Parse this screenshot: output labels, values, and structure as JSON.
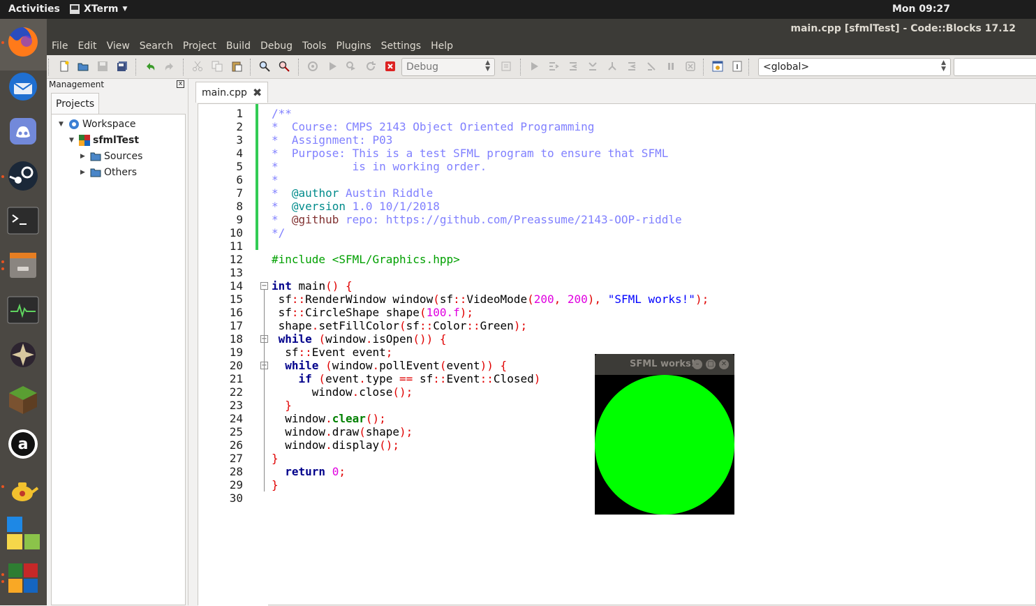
{
  "topbar": {
    "activities": "Activities",
    "app": "XTerm",
    "clock": "Mon 09:27"
  },
  "window": {
    "title": "main.cpp [sfmlTest] - Code::Blocks 17.12"
  },
  "menu": [
    "File",
    "Edit",
    "View",
    "Search",
    "Project",
    "Build",
    "Debug",
    "Tools",
    "Plugins",
    "Settings",
    "Help"
  ],
  "toolbar": {
    "build_target": "Debug",
    "scope": "<global>"
  },
  "management": {
    "header": "Management",
    "close": "x",
    "tab": "Projects",
    "tree": {
      "workspace": "Workspace",
      "project": "sfmlTest",
      "sources": "Sources",
      "others": "Others"
    }
  },
  "editor": {
    "tab": "main.cpp",
    "tab_close": "✖",
    "line_numbers": [
      "1",
      "2",
      "3",
      "4",
      "5",
      "6",
      "7",
      "8",
      "9",
      "10",
      "11",
      "12",
      "13",
      "14",
      "15",
      "16",
      "17",
      "18",
      "19",
      "20",
      "21",
      "22",
      "23",
      "24",
      "25",
      "26",
      "27",
      "28",
      "29",
      "30"
    ],
    "lines": {
      "l1": "/**",
      "l2": "*  Course: CMPS 2143 Object Oriented Programming",
      "l3": "*  Assignment: P03",
      "l4": "*  Purpose: This is a test SFML program to ensure that SFML",
      "l5": "*           is in working order.",
      "l6": "*",
      "l7_a": "*  ",
      "l7_b": "@author",
      "l7_c": " Austin Riddle",
      "l8_a": "*  ",
      "l8_b": "@version",
      "l8_c": " 1.0 10/1/2018",
      "l9_a": "*  ",
      "l9_b": "@github",
      "l9_c": " repo: https://github.com/Preassume/2143-OOP-riddle",
      "l10": "*/",
      "l12": "#include <SFML/Graphics.hpp>",
      "l14_kw": "int",
      "l14_a": " main",
      "l14_b": "()",
      "l14_c": " ",
      "l14_d": "{",
      "l15_a": " sf",
      "l15_b": "::",
      "l15_c": "RenderWindow window",
      "l15_d": "(",
      "l15_e": "sf",
      "l15_f": "::",
      "l15_g": "VideoMode",
      "l15_h": "(",
      "l15_i": "200",
      "l15_j": ", ",
      "l15_k": "200",
      "l15_l": "), ",
      "l15_m": "\"SFML works!\"",
      "l15_n": ");",
      "l16_a": " sf",
      "l16_b": "::",
      "l16_c": "CircleShape shape",
      "l16_d": "(",
      "l16_e": "100.f",
      "l16_f": ");",
      "l17_a": " shape",
      "l17_b": ".",
      "l17_c": "setFillColor",
      "l17_d": "(",
      "l17_e": "sf",
      "l17_f": "::",
      "l17_g": "Color",
      "l17_h": "::",
      "l17_i": "Green",
      "l17_j": ");",
      "l18_a": " ",
      "l18_kw": "while",
      "l18_b": " (",
      "l18_c": "window",
      "l18_d": ".",
      "l18_e": "isOpen",
      "l18_f": "()) {",
      "l19_a": "  sf",
      "l19_b": "::",
      "l19_c": "Event event",
      "l19_d": ";",
      "l20_a": "  ",
      "l20_kw": "while",
      "l20_b": " (",
      "l20_c": "window",
      "l20_d": ".",
      "l20_e": "pollEvent",
      "l20_f": "(",
      "l20_g": "event",
      "l20_h": ")) {",
      "l21_a": "    ",
      "l21_kw": "if",
      "l21_b": " (",
      "l21_c": "event",
      "l21_d": ".",
      "l21_e": "type ",
      "l21_f": "==",
      "l21_g": " sf",
      "l21_h": "::",
      "l21_i": "Event",
      "l21_j": "::",
      "l21_k": "Closed",
      "l21_l": ")",
      "l22_a": "      window",
      "l22_b": ".",
      "l22_c": "close",
      "l22_d": "();",
      "l23": "  }",
      "l24_a": "  window",
      "l24_b": ".",
      "l24_c": "clear",
      "l24_d": "();",
      "l25_a": "  window",
      "l25_b": ".",
      "l25_c": "draw",
      "l25_d": "(",
      "l25_e": "shape",
      "l25_f": ");",
      "l26_a": "  window",
      "l26_b": ".",
      "l26_c": "display",
      "l26_d": "();",
      "l27": "}",
      "l28_a": "  ",
      "l28_kw": "return",
      "l28_b": " ",
      "l28_c": "0",
      "l28_d": ";",
      "l29": "}"
    }
  },
  "sfml_window": {
    "title": "SFML works!",
    "shape_color": "#00ff00"
  },
  "colors": {
    "accent": "#e95420",
    "changebar": "#33cc55"
  },
  "dock_icons": [
    "firefox-icon",
    "thunderbird-icon",
    "discord-icon",
    "steam-icon",
    "terminal-icon",
    "files-icon",
    "system-monitor-icon",
    "app-icon",
    "minecraft-icon",
    "amazon-icon",
    "teapot-icon",
    "tiles-icon",
    "codeblocks-icon"
  ]
}
